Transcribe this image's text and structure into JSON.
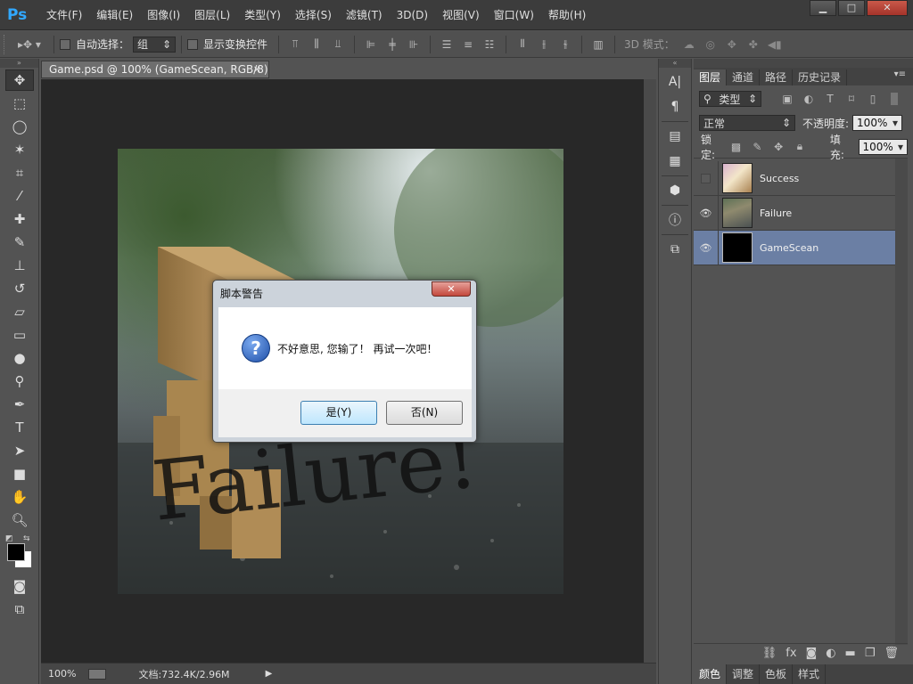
{
  "app": {
    "logo": "Ps"
  },
  "menu": [
    "文件(F)",
    "编辑(E)",
    "图像(I)",
    "图层(L)",
    "类型(Y)",
    "选择(S)",
    "滤镜(T)",
    "3D(D)",
    "视图(V)",
    "窗口(W)",
    "帮助(H)"
  ],
  "window_controls": {
    "minimize": "▁",
    "maximize": "□",
    "close": "✕"
  },
  "options": {
    "auto_select_label": "自动选择：",
    "auto_select_value": "组",
    "show_transform_label": "显示变换控件",
    "mode_3d_label": "3D 模式："
  },
  "document": {
    "tab_title": "Game.psd @ 100% (GameScean, RGB/8) *",
    "tab_close": "×",
    "overlay_text": "Failure!",
    "zoom": "100%",
    "doc_info": "文档:732.4K/2.96M"
  },
  "dialog": {
    "title": "脚本警告",
    "close_label": "✕",
    "icon_glyph": "?",
    "message": "不好意思, 您输了！ 再试一次吧！",
    "yes_label": "是(Y)",
    "no_label": "否(N)"
  },
  "layers_panel": {
    "tabs": [
      "图层",
      "通道",
      "路径",
      "历史记录"
    ],
    "filter_label": "类型",
    "blend_mode": "正常",
    "opacity_label": "不透明度:",
    "opacity_value": "100%",
    "lock_label": "锁定:",
    "fill_label": "填充:",
    "fill_value": "100%",
    "layers": [
      {
        "name": "Success",
        "visible": false,
        "selected": false
      },
      {
        "name": "Failure",
        "visible": true,
        "selected": false
      },
      {
        "name": "GameScean",
        "visible": true,
        "selected": true
      }
    ],
    "bottom_tabs": [
      "颜色",
      "调整",
      "色板",
      "样式"
    ]
  },
  "colors": {
    "selected_layer": "#6b7fa4",
    "ps_blue": "#31a8ff"
  }
}
